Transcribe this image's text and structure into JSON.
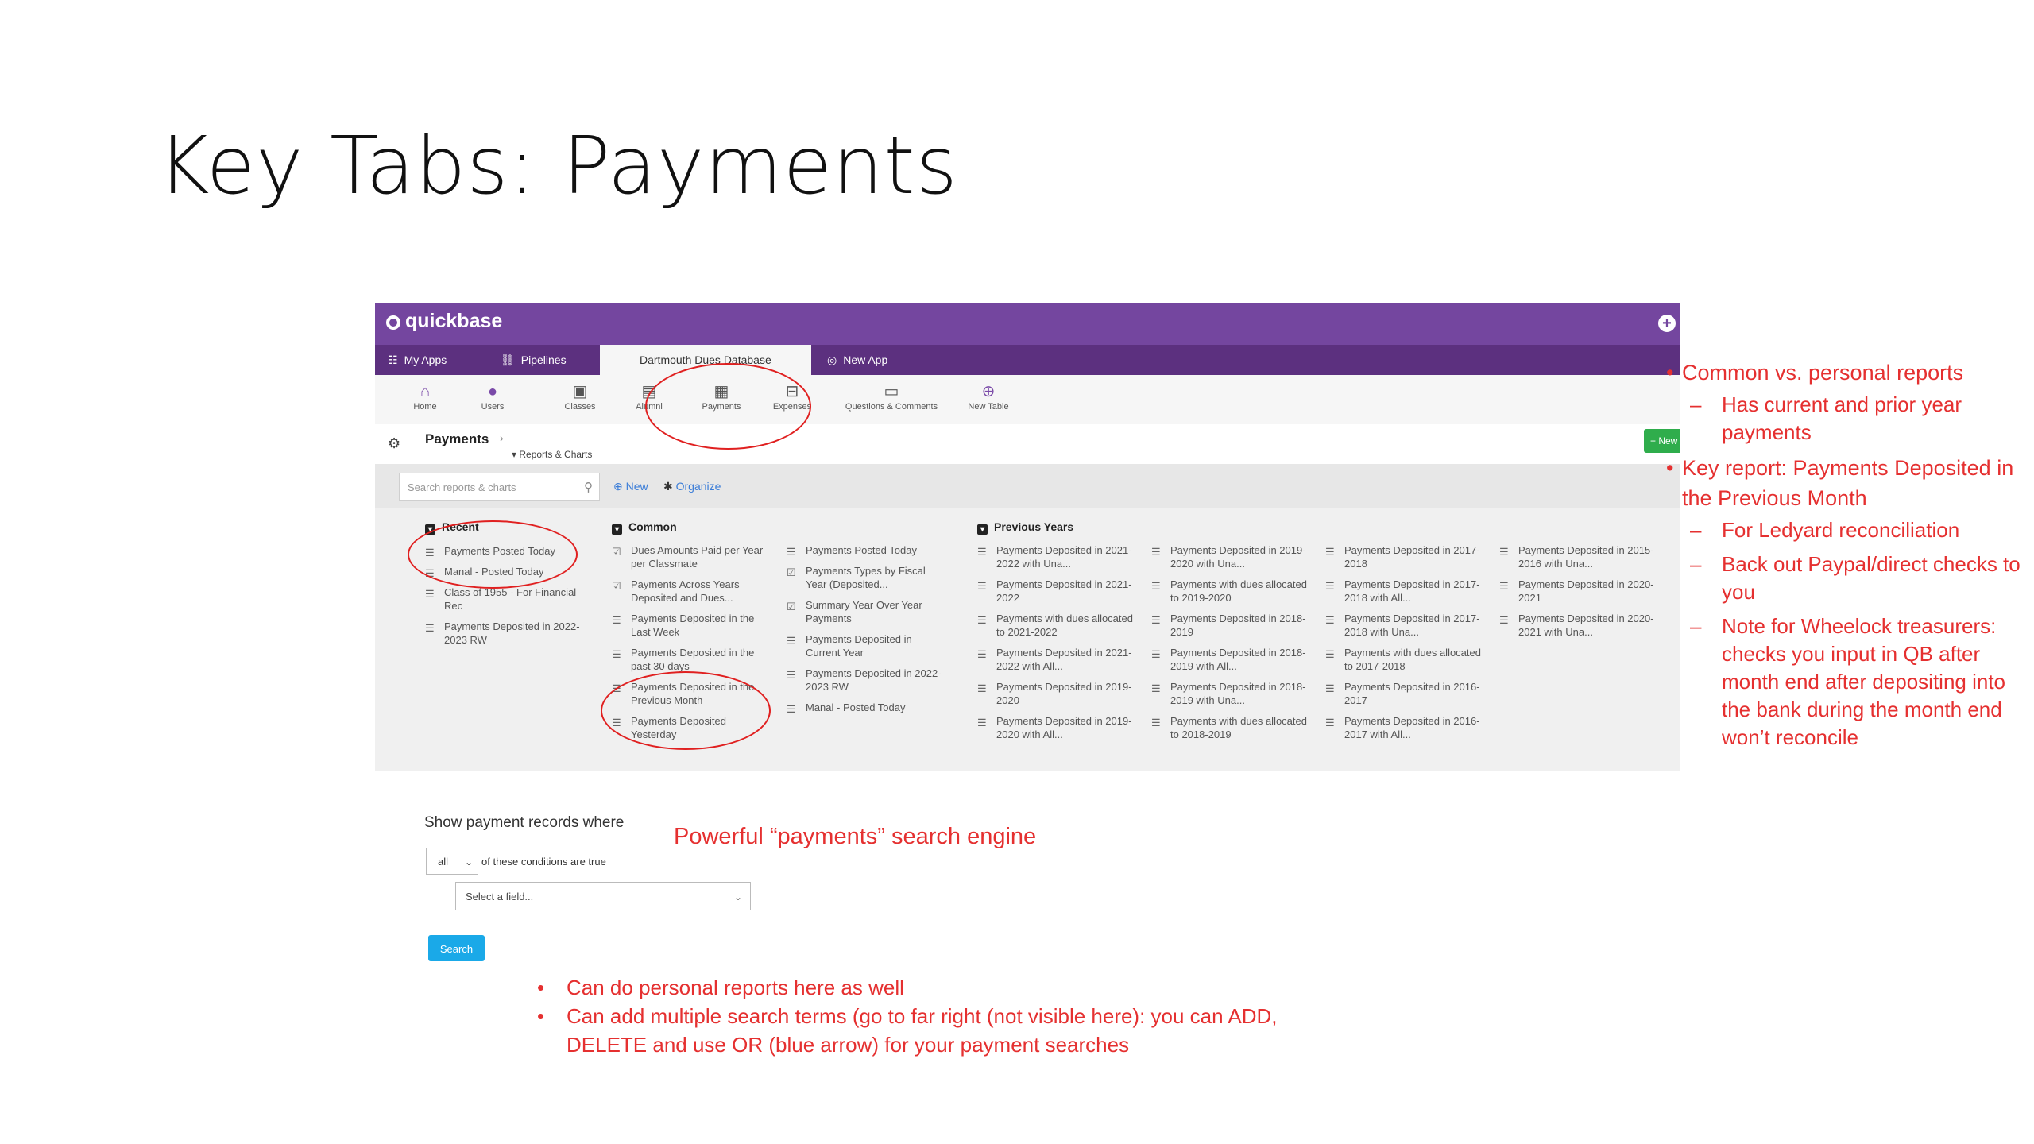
{
  "slide": {
    "title": "Key Tabs: Payments"
  },
  "app": {
    "logo": "quickbase",
    "plus_icon": "plus-circle-icon",
    "tabs": [
      {
        "label": "My Apps",
        "icon": "grid-icon"
      },
      {
        "label": "Pipelines",
        "icon": "pipelines-icon"
      },
      {
        "label": "Dartmouth Dues Database",
        "icon": ""
      },
      {
        "label": "New App",
        "icon": "new-app-icon"
      }
    ],
    "toolbar": [
      {
        "label": "Home",
        "icon": "home-icon"
      },
      {
        "label": "Users",
        "icon": "user-icon"
      },
      {
        "label": "Classes",
        "icon": "classes-icon"
      },
      {
        "label": "Alumni",
        "icon": "alumni-icon"
      },
      {
        "label": "Payments",
        "icon": "payments-icon"
      },
      {
        "label": "Expenses",
        "icon": "expenses-icon"
      },
      {
        "label": "Questions & Comments",
        "icon": "comments-icon"
      },
      {
        "label": "New Table",
        "icon": "add-icon"
      }
    ],
    "header": {
      "title": "Payments",
      "subtitle": "Reports & Charts",
      "new_button": "+ New"
    },
    "search": {
      "placeholder": "Search reports & charts",
      "new_label": "New",
      "organize_label": "Organize"
    },
    "recent": {
      "heading": "Recent",
      "items": [
        "Payments Posted Today",
        "Manal - Posted Today",
        "Class of 1955 - For Financial Rec",
        "Payments Deposited in 2022-2023 RW"
      ]
    },
    "common": {
      "heading": "Common",
      "col1": [
        "Dues Amounts Paid per Year per Classmate",
        "Payments Across Years Deposited and Dues...",
        "Payments Deposited in the Last Week",
        "Payments Deposited in the past 30 days",
        "Payments Deposited in the Previous Month",
        "Payments Deposited Yesterday"
      ],
      "col2": [
        "Payments Posted Today",
        "Payments Types by Fiscal Year (Deposited...",
        "Summary Year Over Year Payments",
        "Payments Deposited in Current Year",
        "Payments Deposited in 2022-2023 RW",
        "Manal - Posted Today"
      ]
    },
    "previous": {
      "heading": "Previous Years",
      "col1": [
        "Payments Deposited in 2021-2022 with Una...",
        "Payments Deposited in 2021-2022",
        "Payments with dues allocated to 2021-2022",
        "Payments Deposited in 2021-2022 with All...",
        "Payments Deposited in 2019-2020",
        "Payments Deposited in 2019-2020 with All..."
      ],
      "col2": [
        "Payments Deposited in 2019-2020 with Una...",
        "Payments with dues allocated to 2019-2020",
        "Payments Deposited in 2018-2019",
        "Payments Deposited in 2018-2019 with All...",
        "Payments Deposited in 2018-2019 with Una...",
        "Payments with dues allocated to 2018-2019"
      ],
      "col3": [
        "Payments Deposited in 2017-2018",
        "Payments Deposited in 2017-2018 with All...",
        "Payments Deposited in 2017-2018 with Una...",
        "Payments with dues allocated to 2017-2018",
        "Payments Deposited in 2016-2017",
        "Payments Deposited in 2016-2017 with All..."
      ],
      "col4": [
        "Payments Deposited in 2015-2016 with Una...",
        "Payments Deposited in 2020-2021",
        "Payments Deposited in 2020-2021 with Una..."
      ]
    }
  },
  "notes": {
    "n1": "Common vs. personal reports",
    "n1a": "Has current and prior year payments",
    "n2": "Key report:  Payments Deposited in the Previous Month",
    "n2a": "For Ledyard reconciliation",
    "n2b": "Back out Paypal/direct checks to you",
    "n2c": "Note for Wheelock treasurers: checks you input in QB after month end after depositing into the bank during the month end won’t reconcile"
  },
  "search_panel": {
    "label": "Show payment records where",
    "match": "all",
    "conditions_text": "of these conditions are true",
    "field_placeholder": "Select a field...",
    "button": "Search",
    "engine_note": "Powerful “payments” search engine",
    "bullets": [
      "Can do personal reports here as well",
      "Can add multiple search terms (go to far right (not visible here):  you can ADD, DELETE and use OR (blue arrow) for your payment searches"
    ]
  },
  "colors": {
    "header": "#74469f",
    "tabbar": "#5c307f",
    "annotation": "#e53030",
    "search_button": "#1aa9e8",
    "new_button": "#2fad4c"
  }
}
